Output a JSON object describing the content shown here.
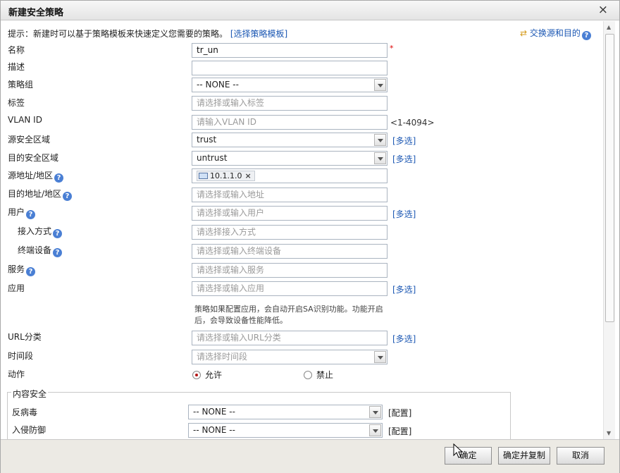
{
  "dialog": {
    "title": "新建安全策略",
    "close": "×"
  },
  "hint": {
    "text": "提示：新建时可以基于策略模板来快速定义您需要的策略。",
    "link": "[选择策略模板]"
  },
  "swap_link": "交换源和目的",
  "help_glyph": "?",
  "fields": {
    "name": {
      "label": "名称",
      "value": "tr_un",
      "required_mark": "*"
    },
    "description": {
      "label": "描述",
      "value": ""
    },
    "policy_group": {
      "label": "策略组",
      "value": "-- NONE --"
    },
    "tag": {
      "label": "标签",
      "placeholder": "请选择或输入标签"
    },
    "vlan_id": {
      "label": "VLAN ID",
      "placeholder": "请输入VLAN ID",
      "range": "<1-4094>"
    },
    "src_zone": {
      "label": "源安全区域",
      "value": "trust",
      "multi": "[多选]"
    },
    "dst_zone": {
      "label": "目的安全区域",
      "value": "untrust",
      "multi": "[多选]"
    },
    "src_addr": {
      "label": "源地址/地区",
      "tag_value": "10.1.1.0",
      "tag_remove": "×"
    },
    "dst_addr": {
      "label": "目的地址/地区",
      "placeholder": "请选择或输入地址"
    },
    "user": {
      "label": "用户",
      "placeholder": "请选择或输入用户",
      "multi": "[多选]"
    },
    "access_mode": {
      "label": "接入方式",
      "placeholder": "请选择接入方式"
    },
    "terminal": {
      "label": "终端设备",
      "placeholder": "请选择或输入终端设备"
    },
    "service": {
      "label": "服务",
      "placeholder": "请选择或输入服务"
    },
    "application": {
      "label": "应用",
      "placeholder": "请选择或输入应用",
      "multi": "[多选]",
      "note": "策略如果配置应用，会自动开启SA识别功能。功能开启后，会导致设备性能降低。"
    },
    "url_category": {
      "label": "URL分类",
      "placeholder": "请选择或输入URL分类",
      "multi": "[多选]"
    },
    "time_range": {
      "label": "时间段",
      "placeholder": "请选择时间段"
    },
    "action": {
      "label": "动作",
      "options": [
        "允许",
        "禁止"
      ],
      "selected": "允许"
    }
  },
  "content_security": {
    "legend": "内容安全",
    "antivirus": {
      "label": "反病毒",
      "value": "-- NONE --",
      "config": "[配置]"
    },
    "ips": {
      "label": "入侵防御",
      "value": "-- NONE --",
      "config": "[配置]"
    }
  },
  "footer": {
    "ok": "确定",
    "ok_copy": "确定并复制",
    "cancel": "取消"
  }
}
